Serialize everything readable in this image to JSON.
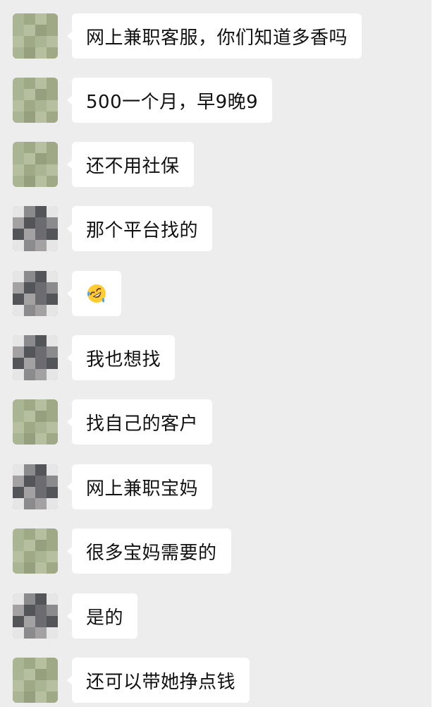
{
  "messages": [
    {
      "avatar": "green",
      "text": "网上兼职客服，你们知道多香吗"
    },
    {
      "avatar": "green",
      "text": "500一个月，早9晚9"
    },
    {
      "avatar": "green",
      "text": "还不用社保"
    },
    {
      "avatar": "gray",
      "text": "那个平台找的"
    },
    {
      "avatar": "gray",
      "emoji": "rolling-on-floor-laughing-emoji"
    },
    {
      "avatar": "gray",
      "text": "我也想找"
    },
    {
      "avatar": "green",
      "text": "找自己的客户"
    },
    {
      "avatar": "gray",
      "text": "网上兼职宝妈"
    },
    {
      "avatar": "green",
      "text": "很多宝妈需要的"
    },
    {
      "avatar": "gray",
      "text": "是的"
    },
    {
      "avatar": "green",
      "text": "还可以带她挣点钱"
    }
  ]
}
